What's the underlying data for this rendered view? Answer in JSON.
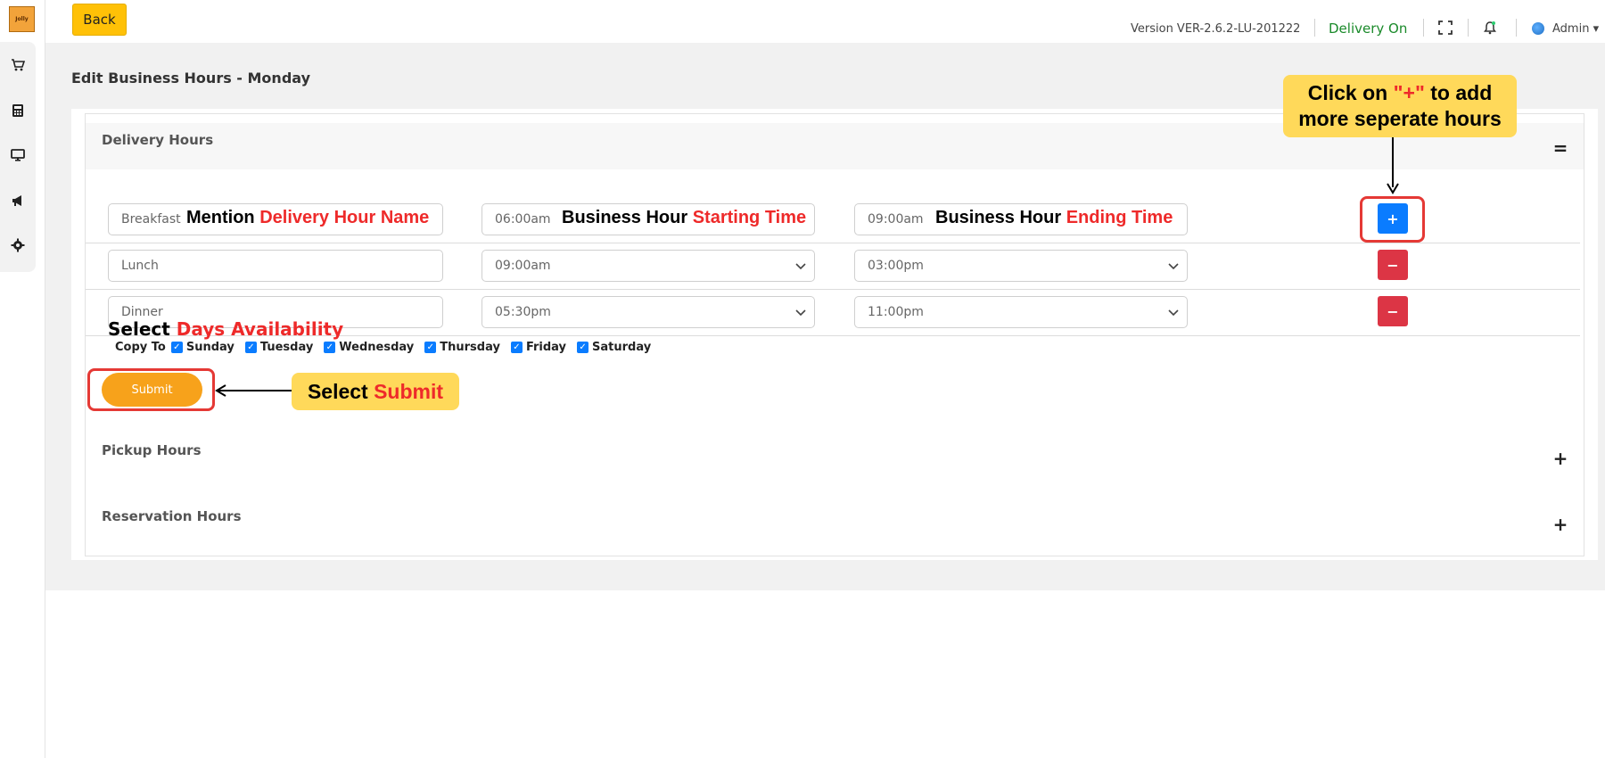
{
  "logo": {
    "text": "Jolly"
  },
  "sidebar": {
    "items": [
      {
        "icon": "cart-icon"
      },
      {
        "icon": "calculator-icon"
      },
      {
        "icon": "monitor-icon"
      },
      {
        "icon": "megaphone-icon"
      },
      {
        "icon": "gear-icon"
      }
    ]
  },
  "topbar": {
    "back_label": "Back",
    "version": "Version VER-2.6.2-LU-201222",
    "delivery_status": "Delivery On",
    "admin_label": "Admin ▾"
  },
  "page": {
    "title": "Edit Business Hours - Monday"
  },
  "delivery_section": {
    "title": "Delivery Hours",
    "toggle": "=",
    "rows": [
      {
        "name": "Breakfast",
        "start": "06:00am",
        "end": "09:00am",
        "button": "+"
      },
      {
        "name": "Lunch",
        "start": "09:00am",
        "end": "03:00pm",
        "button": "−"
      },
      {
        "name": "Dinner",
        "start": "05:30pm",
        "end": "11:00pm",
        "button": "−"
      }
    ],
    "copy_to_label": "Copy To",
    "days": [
      "Sunday",
      "Tuesday",
      "Wednesday",
      "Thursday",
      "Friday",
      "Saturday"
    ],
    "submit_label": "Submit"
  },
  "pickup_section": {
    "title": "Pickup Hours",
    "toggle": "+"
  },
  "reservation_section": {
    "title": "Reservation Hours",
    "toggle": "+"
  },
  "annotations": {
    "name_a": "Mention ",
    "name_b": "Delivery Hour Name",
    "start_a": "Business Hour ",
    "start_b": "Starting Time",
    "end_a": "Business Hour ",
    "end_b": "Ending  Time",
    "plus_1": "Click on ",
    "plus_2": "\"+\"",
    "plus_3": " to add",
    "plus_4": "more seperate hours",
    "days_a": "Select ",
    "days_b": "Days Availability",
    "submit_a": "Select ",
    "submit_b": "Submit"
  },
  "colors": {
    "back": "#ffc107",
    "add": "#0a7cff",
    "remove": "#dc3545",
    "submit": "#f7a21b",
    "delivery_on": "#1a8a2a",
    "annotation_red": "#ee2a2a",
    "bubble": "#ffd95a"
  }
}
